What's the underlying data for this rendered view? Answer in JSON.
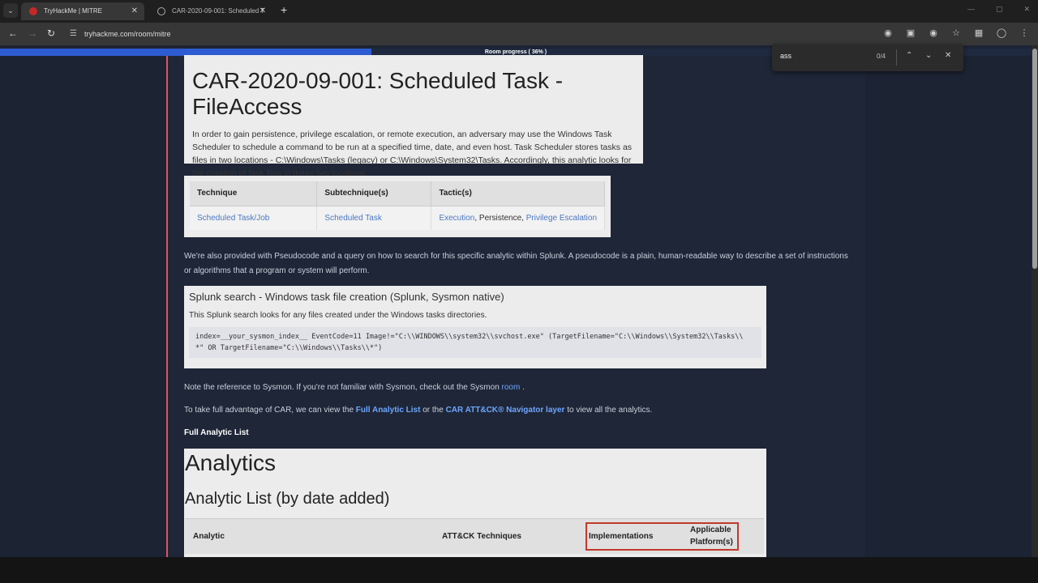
{
  "browser": {
    "tabs": [
      {
        "title": "TryHackMe | MITRE"
      },
      {
        "title": "CAR-2020-09-001: Scheduled T"
      }
    ],
    "url": "tryhackme.com/room/mitre",
    "find": {
      "query": "ass",
      "count": "0/4"
    }
  },
  "progress": {
    "label": "Room progress ( 36% )",
    "percent": 36
  },
  "car": {
    "title": "CAR-2020-09-001: Scheduled Task - FileAccess",
    "description": "In order to gain persistence, privilege escalation, or remote execution, an adversary may use the Windows Task Scheduler to schedule a command to be run at a specified time, date, and even host. Task Scheduler stores tasks as files in two locations - C:\\Windows\\Tasks (legacy) or C:\\Windows\\System32\\Tasks. Accordingly, this analytic looks for the creation of task files in these two locations."
  },
  "technique_table": {
    "headers": [
      "Technique",
      "Subtechnique(s)",
      "Tactic(s)"
    ],
    "row": {
      "technique": "Scheduled Task/Job",
      "subtechnique": "Scheduled Task",
      "tactic1": "Execution",
      "sep1": ", ",
      "tactic2": "Persistence",
      "sep2": ", ",
      "tactic3": "Privilege Escalation"
    }
  },
  "pseudocode_para": {
    "before": "We're also provided with Pseudocode and a query on how to search for this specific analytic within Splunk. A pseudocode is a plain, human-readable way to describe a set of instructions or algorithms that a program or system will perform."
  },
  "splunk": {
    "title": "Splunk search - Windows task file creation (Splunk, Sysmon native)",
    "description": "This Splunk search looks for any files created under the Windows tasks directories.",
    "code_line1": "index=__your_sysmon_index__ EventCode=11 Image!=\"C:\\\\WINDOWS\\\\system32\\\\svchost.exe\" (TargetFilename=\"C:\\\\Windows\\\\System32\\\\Tasks\\\\",
    "code_line2": "*\" OR TargetFilename=\"C:\\\\Windows\\\\Tasks\\\\*\")"
  },
  "sysmon_note": {
    "before": "Note the reference to Sysmon. If you're not familiar with Sysmon, check out the Sysmon ",
    "link": "room",
    "after": " ."
  },
  "car_note": {
    "before": "To take full advantage of CAR, we can view the ",
    "link1": "Full Analytic List",
    "middle": " or the ",
    "link2": "CAR ATT&CK® Navigator layer",
    "after": " to view all the analytics."
  },
  "full_list_heading": "Full Analytic List",
  "analytics": {
    "title": "Analytics",
    "subtitle": "Analytic List (by date added)",
    "headers": [
      "Analytic",
      "ATT&CK Techniques",
      "Implementations",
      "Applicable",
      "Platform(s)"
    ]
  }
}
